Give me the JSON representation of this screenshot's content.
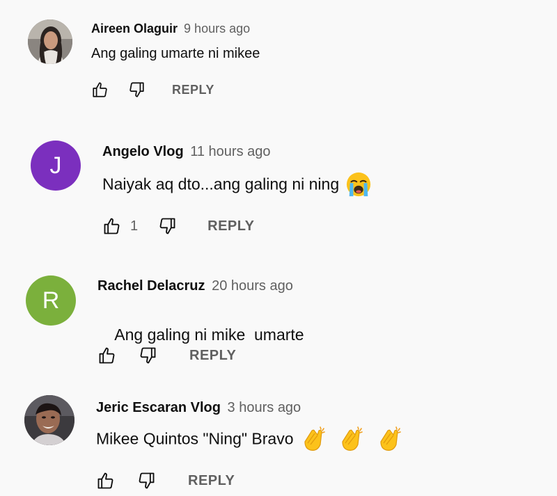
{
  "colors": {
    "background": "#f9f9f9",
    "author": "#0f0f0f",
    "secondary_text": "#606060",
    "avatar_j": "#7b2fbe",
    "avatar_r": "#7bb03c"
  },
  "comments": [
    {
      "author": "Aireen Olaguir",
      "time": "9 hours ago",
      "text": "Ang galing umarte ni mikee",
      "avatar": {
        "type": "photo",
        "icon": "profile-photo"
      },
      "likes": "",
      "reply_label": "REPLY"
    },
    {
      "author": "Angelo Vlog",
      "time": "11 hours ago",
      "text": "Naiyak aq dto...ang galing ni ning",
      "emojis": [
        "loudly-crying-face-emoji"
      ],
      "avatar": {
        "type": "letter",
        "letter": "J",
        "color": "#7b2fbe"
      },
      "likes": "1",
      "reply_label": "REPLY"
    },
    {
      "author": "Rachel Delacruz",
      "time": "20 hours ago",
      "text": "Ang galing ni mike  umarte",
      "avatar": {
        "type": "letter",
        "letter": "R",
        "color": "#7bb03c"
      },
      "likes": "",
      "reply_label": "REPLY"
    },
    {
      "author": "Jeric Escaran Vlog",
      "time": "3 hours ago",
      "text": "Mikee Quintos \"Ning\" Bravo",
      "emojis": [
        "clapping-hands-emoji",
        "clapping-hands-emoji",
        "clapping-hands-emoji"
      ],
      "avatar": {
        "type": "photo",
        "icon": "profile-photo"
      },
      "likes": "",
      "reply_label": "REPLY"
    }
  ]
}
